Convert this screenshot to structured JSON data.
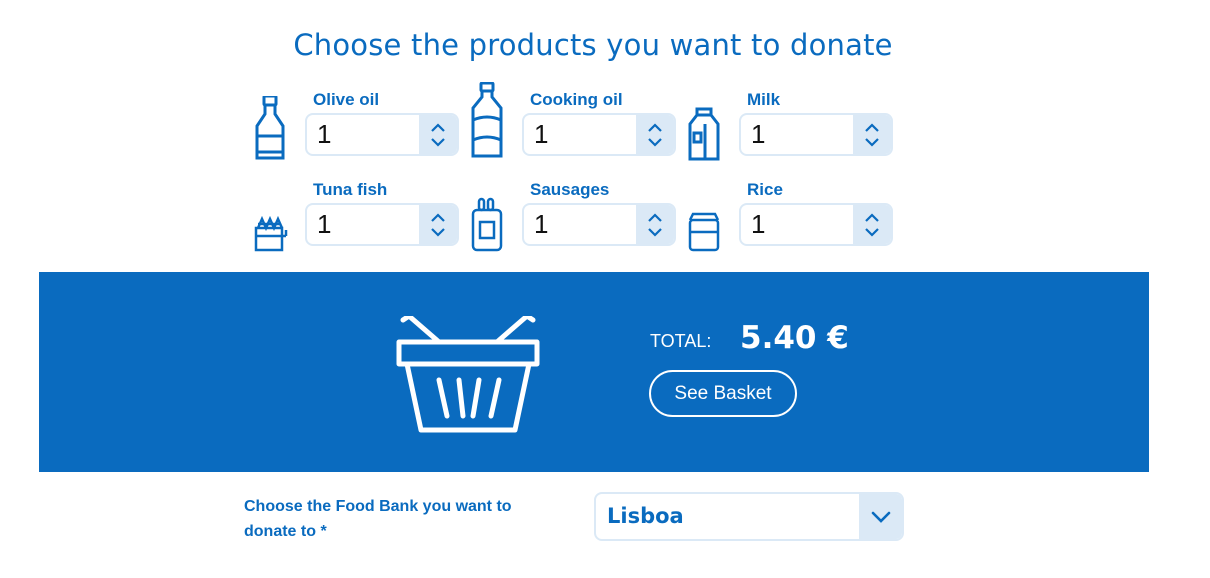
{
  "title": "Choose the products you want to donate",
  "products": [
    {
      "label": "Olive oil",
      "quantity": "1",
      "icon": "olive-oil-bottle-icon"
    },
    {
      "label": "Cooking oil",
      "quantity": "1",
      "icon": "cooking-oil-bottle-icon"
    },
    {
      "label": "Milk",
      "quantity": "1",
      "icon": "milk-carton-icon"
    },
    {
      "label": "Tuna fish",
      "quantity": "1",
      "icon": "tuna-can-icon"
    },
    {
      "label": "Sausages",
      "quantity": "1",
      "icon": "sausages-can-icon"
    },
    {
      "label": "Rice",
      "quantity": "1",
      "icon": "rice-package-icon"
    }
  ],
  "summary": {
    "total_label": "TOTAL:",
    "total_value": "5.40 €",
    "see_basket_label": "See Basket",
    "icon": "basket-icon"
  },
  "food_bank": {
    "label": "Choose the Food Bank you want to donate to *",
    "selected": "Lisboa"
  },
  "colors": {
    "accent": "#0a6bbf",
    "field_border": "#dbe9f6",
    "background": "#ffffff"
  }
}
